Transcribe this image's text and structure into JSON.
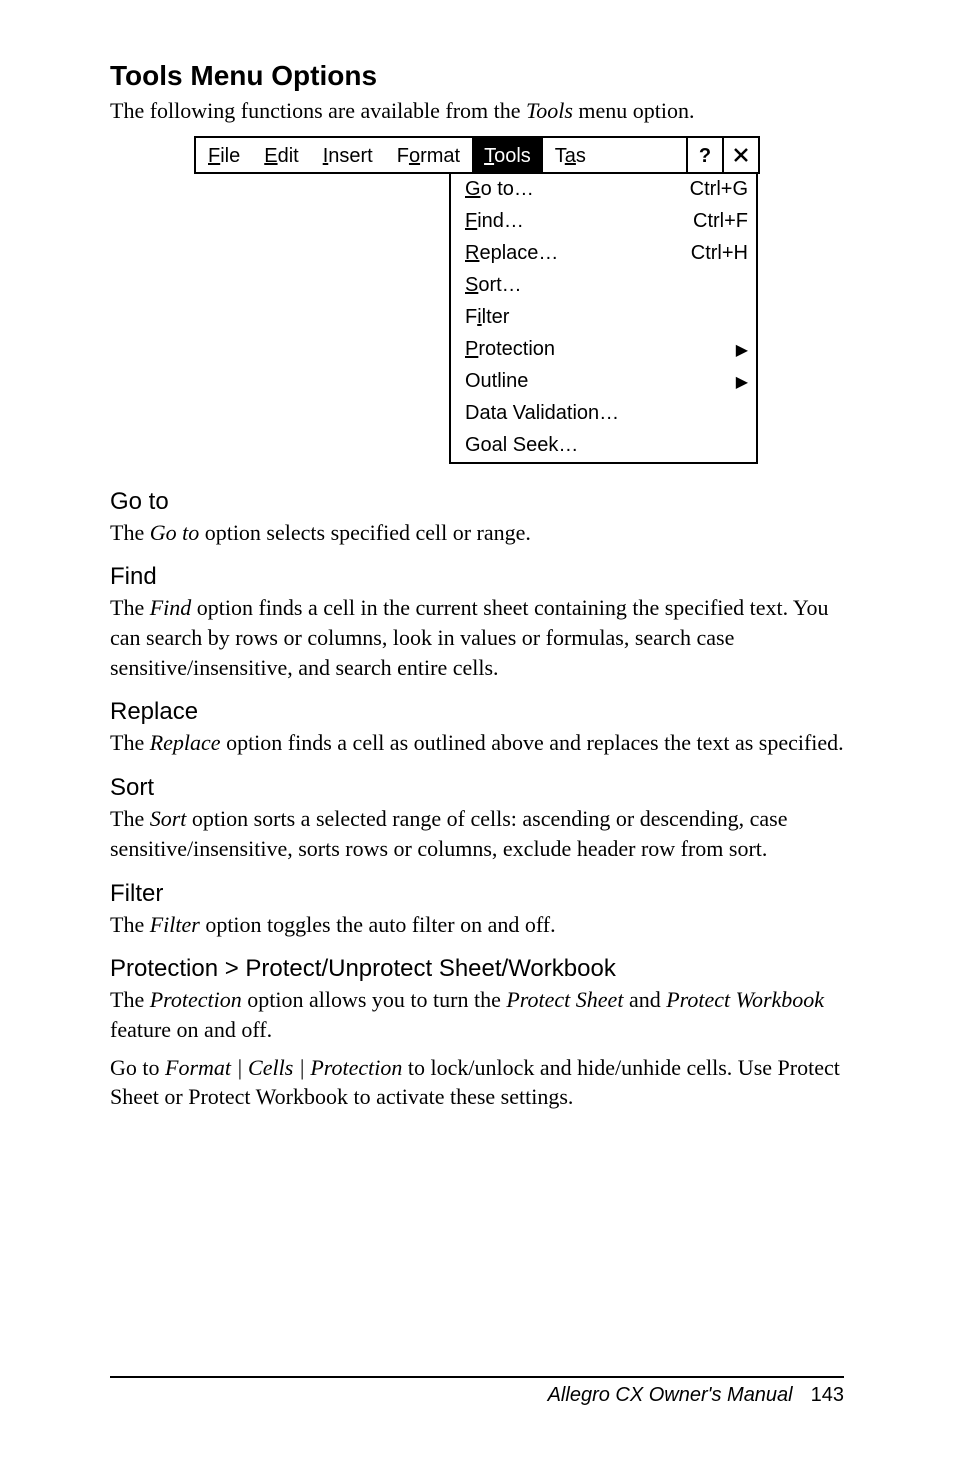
{
  "title": "Tools Menu Options",
  "intro_pre": "The following functions are available from the ",
  "intro_italic": "Tools",
  "intro_post": " menu option.",
  "menubar": {
    "file": {
      "u": "F",
      "rest": "ile"
    },
    "edit": {
      "u": "E",
      "rest": "dit"
    },
    "insert": {
      "u": "I",
      "rest": "nsert"
    },
    "format": {
      "pre": "F",
      "u": "o",
      "post": "rmat"
    },
    "tools": {
      "u": "T",
      "rest": "ools"
    },
    "tas": {
      "pre": "T",
      "u": "a",
      "post": "s"
    },
    "help": "?",
    "close": "×"
  },
  "dropdown": [
    {
      "pre": "",
      "u": "G",
      "post": "o to…",
      "shortcut": "Ctrl+G",
      "submenu": false
    },
    {
      "pre": "",
      "u": "F",
      "post": "ind…",
      "shortcut": "Ctrl+F",
      "submenu": false
    },
    {
      "pre": "",
      "u": "R",
      "post": "eplace…",
      "shortcut": "Ctrl+H",
      "submenu": false
    },
    {
      "pre": "",
      "u": "S",
      "post": "ort…",
      "shortcut": "",
      "submenu": false
    },
    {
      "pre": "F",
      "u": "i",
      "post": "lter",
      "shortcut": "",
      "submenu": false
    },
    {
      "pre": "",
      "u": "P",
      "post": "rotection",
      "shortcut": "",
      "submenu": true
    },
    {
      "pre": "Outline",
      "u": "",
      "post": "",
      "shortcut": "",
      "submenu": true
    },
    {
      "pre": "Data Validation…",
      "u": "",
      "post": "",
      "shortcut": "",
      "submenu": false
    },
    {
      "pre": "Goal Seek…",
      "u": "",
      "post": "",
      "shortcut": "",
      "submenu": false
    }
  ],
  "sections": {
    "goto": {
      "head": "Go to",
      "p1_pre": "The ",
      "p1_i": "Go to",
      "p1_post": " option selects specified cell or range."
    },
    "find": {
      "head": "Find",
      "p1_pre": "The ",
      "p1_i": "Find",
      "p1_post": " option finds a cell in the current sheet containing the specified text. You can search by rows or columns, look in values or formulas, search case sensitive/insensitive, and search entire cells."
    },
    "replace": {
      "head": "Replace",
      "p1_pre": "The ",
      "p1_i": "Replace",
      "p1_post": " option finds a cell as outlined above and replaces the text as specified."
    },
    "sort": {
      "head": "Sort",
      "p1_pre": "The ",
      "p1_i": "Sort",
      "p1_post": " option sorts a selected range of cells: ascending or descending, case sensitive/insensitive, sorts rows or columns, exclude header row from sort."
    },
    "filter": {
      "head": "Filter",
      "p1_pre": "The ",
      "p1_i": "Filter",
      "p1_post": " option toggles the auto filter on and off."
    },
    "protection": {
      "head": "Protection > Protect/Unprotect Sheet/Workbook",
      "p1_pre": "The ",
      "p1_i": "Protection",
      "p1_mid": " option allows you to turn the ",
      "p1_i2": "Protect Sheet",
      "p1_mid2": " and ",
      "p1_i3": "Protect Workbook",
      "p1_post": " feature on and off.",
      "p2_pre": "Go to ",
      "p2_i": "Format | Cells | Protection",
      "p2_post": " to lock/unlock and hide/unhide cells. Use Protect Sheet or Protect Workbook to activate these settings."
    }
  },
  "footer": {
    "title": "Allegro CX Owner's Manual",
    "page": "143"
  }
}
